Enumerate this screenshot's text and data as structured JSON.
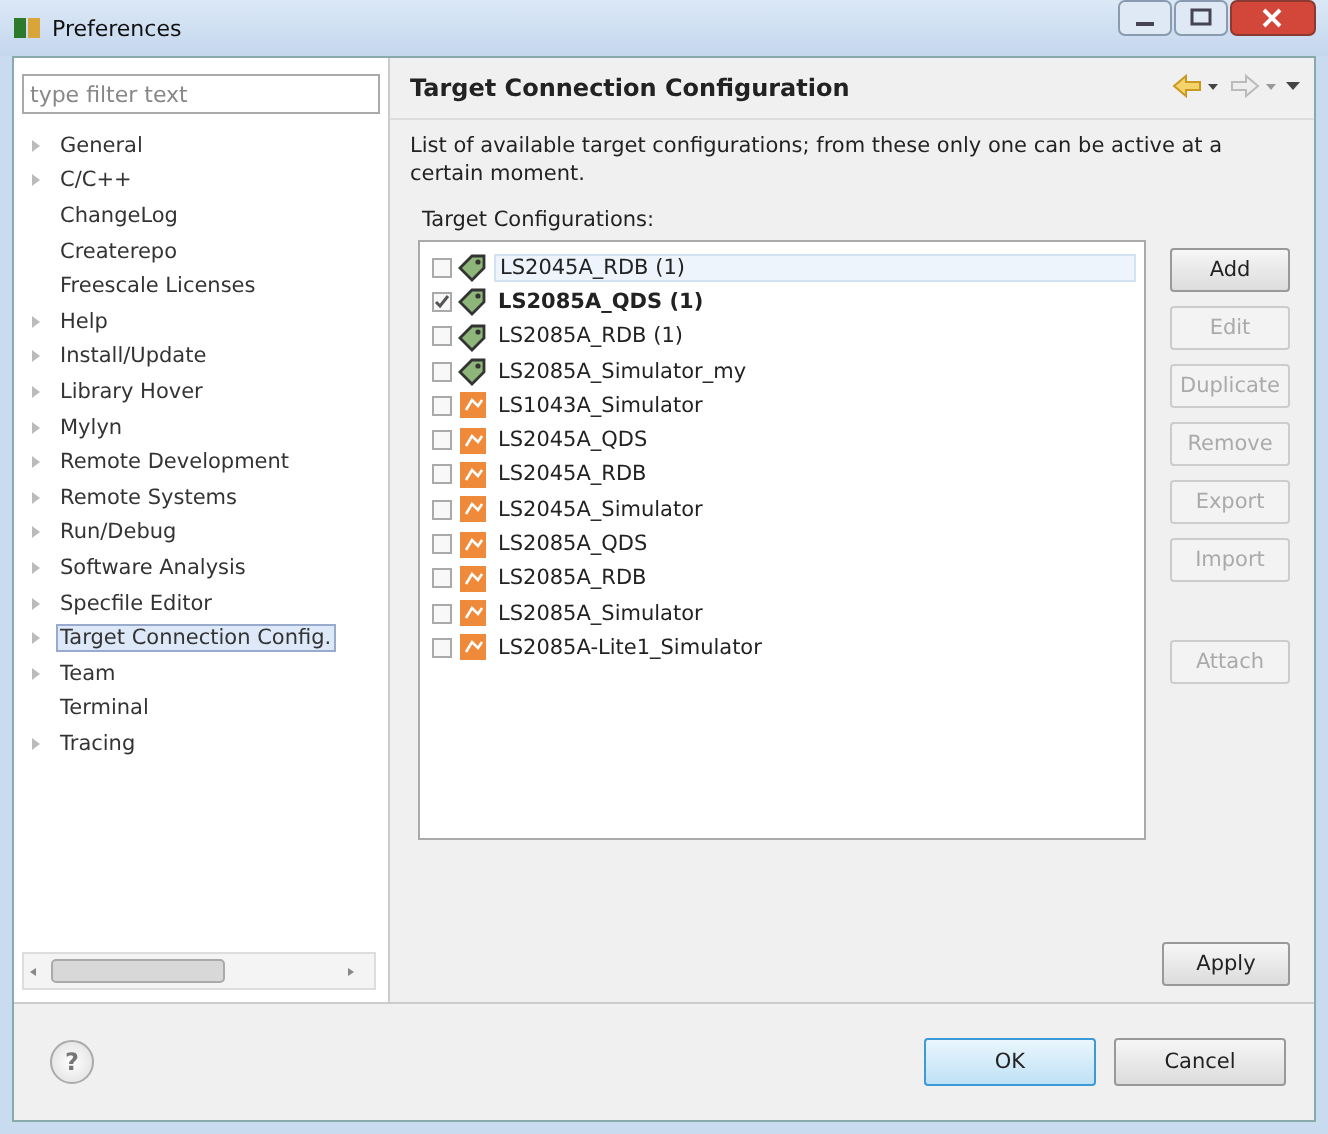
{
  "window": {
    "title": "Preferences"
  },
  "filter": {
    "placeholder": "type filter text"
  },
  "tree": [
    {
      "label": "General",
      "expandable": true,
      "selected": false
    },
    {
      "label": "C/C++",
      "expandable": true,
      "selected": false
    },
    {
      "label": "ChangeLog",
      "expandable": false,
      "selected": false
    },
    {
      "label": "Createrepo",
      "expandable": false,
      "selected": false
    },
    {
      "label": "Freescale Licenses",
      "expandable": false,
      "selected": false
    },
    {
      "label": "Help",
      "expandable": true,
      "selected": false
    },
    {
      "label": "Install/Update",
      "expandable": true,
      "selected": false
    },
    {
      "label": "Library Hover",
      "expandable": true,
      "selected": false
    },
    {
      "label": "Mylyn",
      "expandable": true,
      "selected": false
    },
    {
      "label": "Remote Development",
      "expandable": true,
      "selected": false
    },
    {
      "label": "Remote Systems",
      "expandable": true,
      "selected": false
    },
    {
      "label": "Run/Debug",
      "expandable": true,
      "selected": false
    },
    {
      "label": "Software Analysis",
      "expandable": true,
      "selected": false
    },
    {
      "label": "Specfile Editor",
      "expandable": true,
      "selected": false
    },
    {
      "label": "Target Connection Config.",
      "expandable": true,
      "selected": true
    },
    {
      "label": "Team",
      "expandable": true,
      "selected": false
    },
    {
      "label": "Terminal",
      "expandable": false,
      "selected": false
    },
    {
      "label": "Tracing",
      "expandable": true,
      "selected": false
    }
  ],
  "page": {
    "title": "Target Connection Configuration",
    "description": "List of available target configurations; from these only one can be active at a certain moment.",
    "list_label": "Target Configurations:"
  },
  "configurations": [
    {
      "name": "LS2045A_RDB (1)",
      "kind": "board",
      "checked": false,
      "selected": true
    },
    {
      "name": "LS2085A_QDS (1)",
      "kind": "board",
      "checked": true,
      "selected": false
    },
    {
      "name": "LS2085A_RDB (1)",
      "kind": "board",
      "checked": false,
      "selected": false
    },
    {
      "name": "LS2085A_Simulator_my",
      "kind": "board",
      "checked": false,
      "selected": false
    },
    {
      "name": "LS1043A_Simulator",
      "kind": "simulator",
      "checked": false,
      "selected": false
    },
    {
      "name": "LS2045A_QDS",
      "kind": "simulator",
      "checked": false,
      "selected": false
    },
    {
      "name": "LS2045A_RDB",
      "kind": "simulator",
      "checked": false,
      "selected": false
    },
    {
      "name": "LS2045A_Simulator",
      "kind": "simulator",
      "checked": false,
      "selected": false
    },
    {
      "name": "LS2085A_QDS",
      "kind": "simulator",
      "checked": false,
      "selected": false
    },
    {
      "name": "LS2085A_RDB",
      "kind": "simulator",
      "checked": false,
      "selected": false
    },
    {
      "name": "LS2085A_Simulator",
      "kind": "simulator",
      "checked": false,
      "selected": false
    },
    {
      "name": "LS2085A-Lite1_Simulator",
      "kind": "simulator",
      "checked": false,
      "selected": false
    }
  ],
  "side_buttons": [
    {
      "label": "Add",
      "disabled": false
    },
    {
      "label": "Edit",
      "disabled": true
    },
    {
      "label": "Duplicate",
      "disabled": true
    },
    {
      "label": "Remove",
      "disabled": true
    },
    {
      "label": "Export",
      "disabled": true
    },
    {
      "label": "Import",
      "disabled": true
    },
    {
      "label": "Attach",
      "disabled": true
    }
  ],
  "apply_button": "Apply",
  "help_button": "?",
  "dialog_buttons": [
    {
      "label": "OK",
      "default": true
    },
    {
      "label": "Cancel",
      "default": false
    }
  ]
}
